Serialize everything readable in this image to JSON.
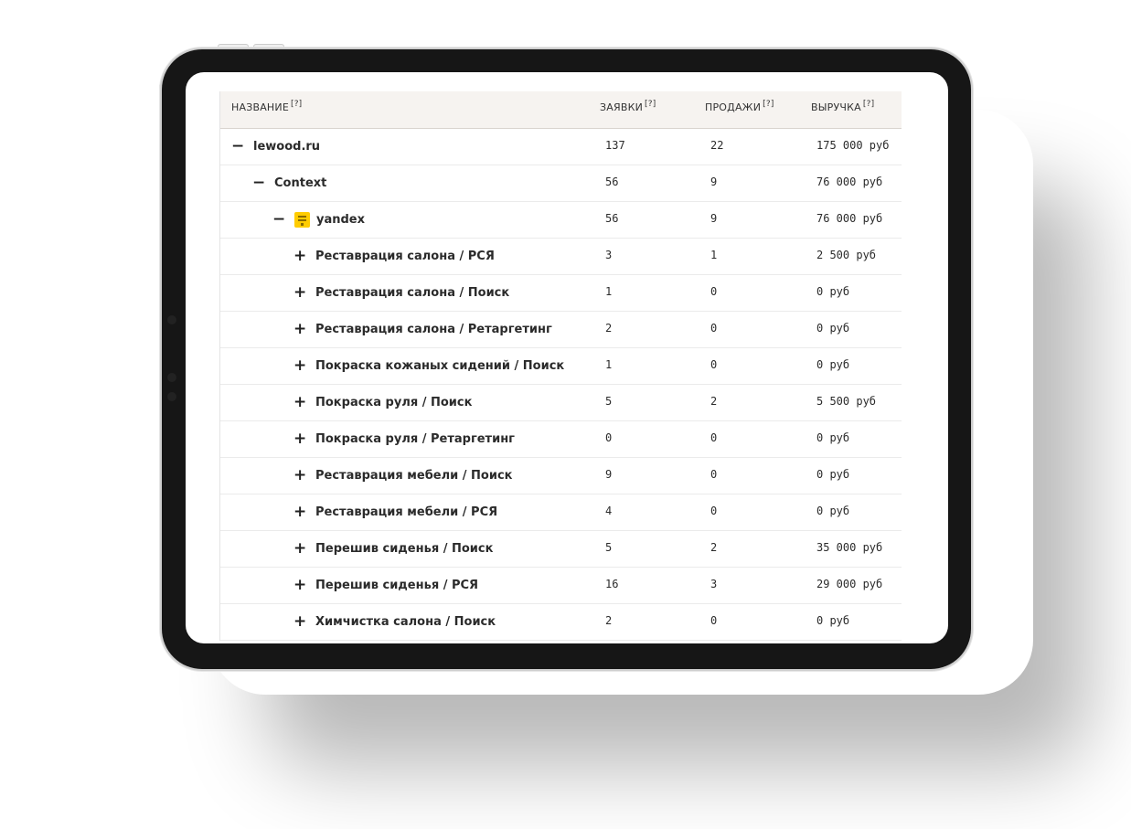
{
  "table": {
    "columns": [
      {
        "label": "НАЗВАНИЕ",
        "hint": "[?]"
      },
      {
        "label": "ЗАЯВКИ",
        "hint": "[?]"
      },
      {
        "label": "ПРОДАЖИ",
        "hint": "[?]"
      },
      {
        "label": "ВЫРУЧКА",
        "hint": "[?]"
      }
    ],
    "rows": [
      {
        "toggle": "−",
        "icon": "",
        "name": "lewood.ru",
        "leads": "137",
        "sales": "22",
        "revenue": "175 000 руб"
      },
      {
        "toggle": "−",
        "icon": "",
        "name": "Context",
        "leads": "56",
        "sales": "9",
        "revenue": "76 000 руб"
      },
      {
        "toggle": "−",
        "icon": "yandex-icon",
        "name": "yandex",
        "leads": "56",
        "sales": "9",
        "revenue": "76 000 руб"
      },
      {
        "toggle": "+",
        "icon": "",
        "name": "Реставрация салона / РСЯ",
        "leads": "3",
        "sales": "1",
        "revenue": "2 500 руб"
      },
      {
        "toggle": "+",
        "icon": "",
        "name": "Реставрация салона / Поиск",
        "leads": "1",
        "sales": "0",
        "revenue": "0 руб"
      },
      {
        "toggle": "+",
        "icon": "",
        "name": "Реставрация салона / Ретаргетинг",
        "leads": "2",
        "sales": "0",
        "revenue": "0 руб"
      },
      {
        "toggle": "+",
        "icon": "",
        "name": "Покраска кожаных сидений / Поиск",
        "leads": "1",
        "sales": "0",
        "revenue": "0 руб"
      },
      {
        "toggle": "+",
        "icon": "",
        "name": "Покраска руля / Поиск",
        "leads": "5",
        "sales": "2",
        "revenue": "5 500 руб"
      },
      {
        "toggle": "+",
        "icon": "",
        "name": "Покраска руля / Ретаргетинг",
        "leads": "0",
        "sales": "0",
        "revenue": "0 руб"
      },
      {
        "toggle": "+",
        "icon": "",
        "name": "Реставрация мебели / Поиск",
        "leads": "9",
        "sales": "0",
        "revenue": "0 руб"
      },
      {
        "toggle": "+",
        "icon": "",
        "name": "Реставрация мебели / РСЯ",
        "leads": "4",
        "sales": "0",
        "revenue": "0 руб"
      },
      {
        "toggle": "+",
        "icon": "",
        "name": "Перешив сиденья / Поиск",
        "leads": "5",
        "sales": "2",
        "revenue": "35 000 руб"
      },
      {
        "toggle": "+",
        "icon": "",
        "name": "Перешив сиденья / РСЯ",
        "leads": "16",
        "sales": "3",
        "revenue": "29 000 руб"
      },
      {
        "toggle": "+",
        "icon": "",
        "name": "Химчистка салона / Поиск",
        "leads": "2",
        "sales": "0",
        "revenue": "0 руб"
      }
    ]
  },
  "colors": {
    "yandex_badge": "#ffcc00",
    "header_bg": "#f6f3f0",
    "device_frame": "#161616"
  }
}
